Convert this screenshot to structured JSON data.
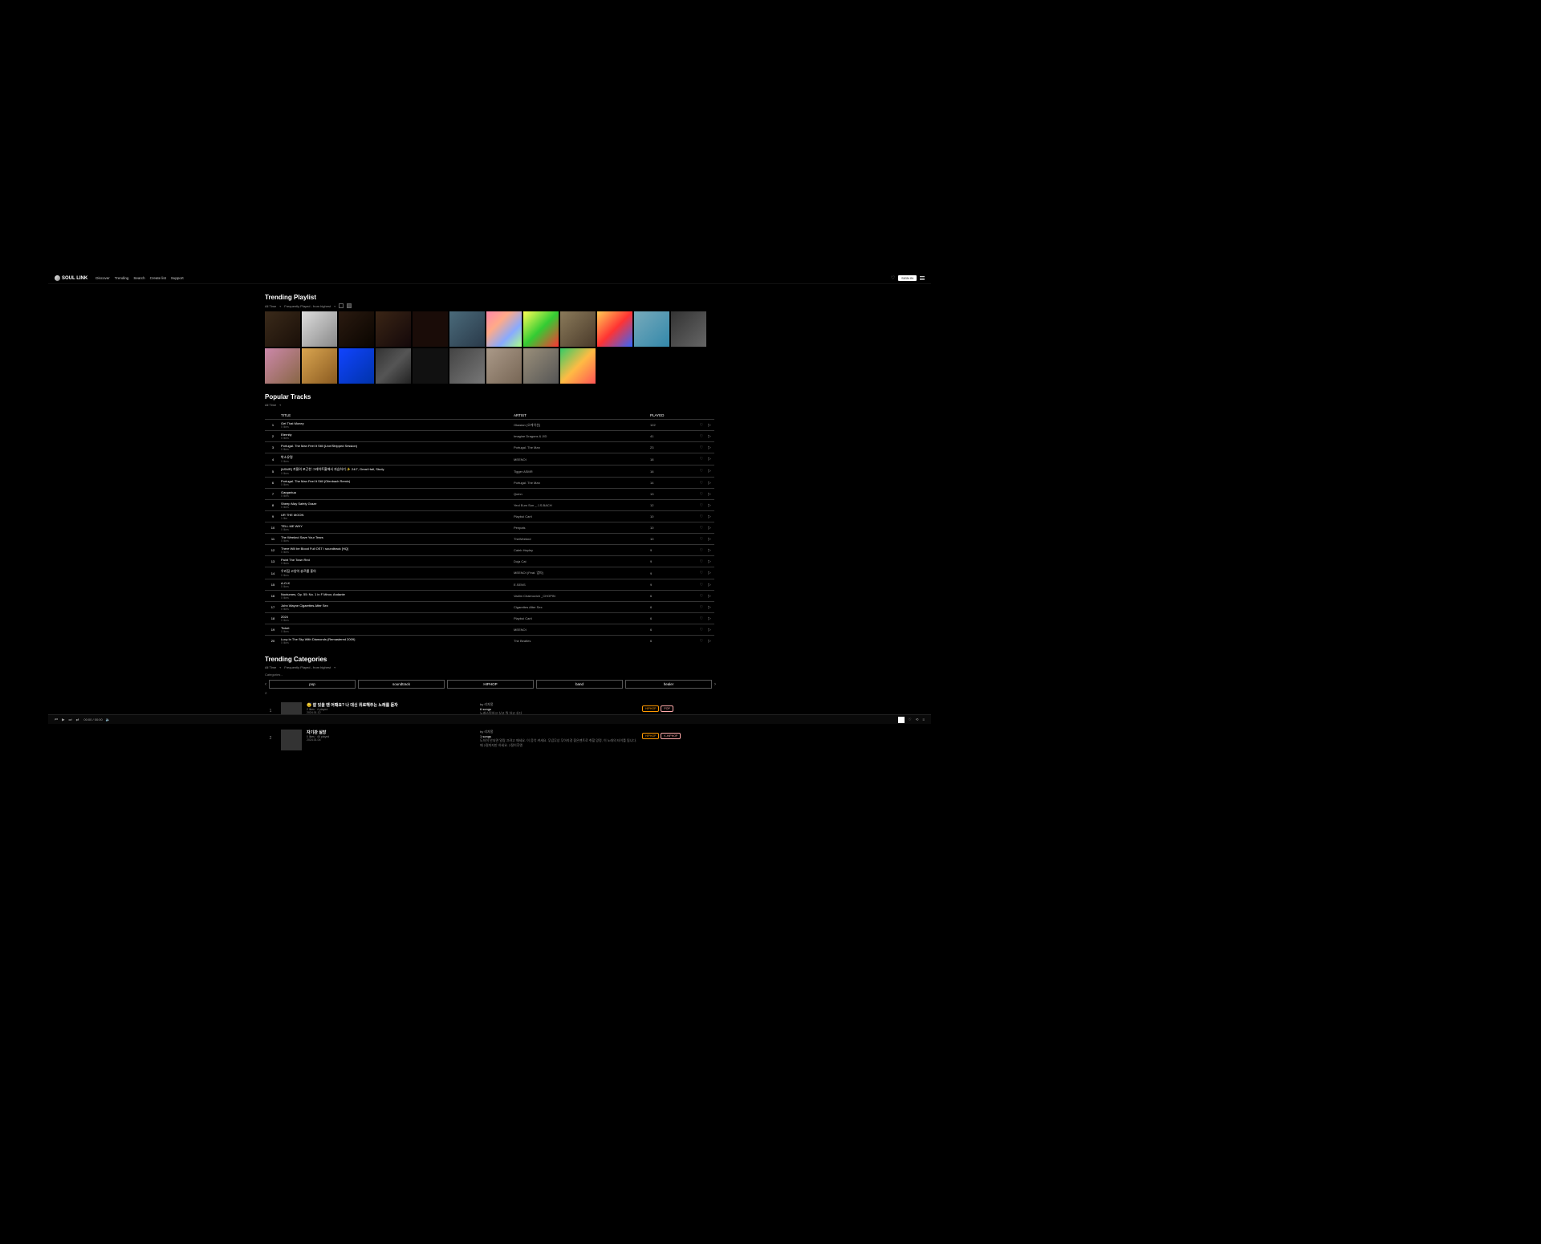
{
  "brand": "SOUL LINK",
  "nav": {
    "discover": "Discover",
    "trending": "Trending",
    "search": "Search",
    "create_list": "Create list",
    "support": "Support"
  },
  "signin": "SIGN IN",
  "sections": {
    "trending_playlist": "Trending Playlist",
    "popular_tracks": "Popular Tracks",
    "trending_categories": "Trending Categories"
  },
  "filters": {
    "all_time": "All Time",
    "freq": "Frequently Played - from highest"
  },
  "table": {
    "title": "TITLE",
    "artist": "ARTIST",
    "played": "PLAYED"
  },
  "category_label": "Categories -",
  "categories": [
    "pop",
    "soundtrack",
    "HIPHOP",
    "band",
    "healer"
  ],
  "tracks": [
    {
      "n": 1,
      "title": "Get That Money",
      "likes": "0 likes",
      "artist": "Okasian (오케이션)",
      "played": "122"
    },
    {
      "n": 2,
      "title": "Eternity",
      "likes": "0 likes",
      "artist": "Imagine Dragons & JID",
      "played": "41"
    },
    {
      "n": 3,
      "title": "Portugal. The Man Feel It Still (Live/Stripped Session)",
      "likes": "0 likes",
      "artist": "Portugal. The Man",
      "played": "23"
    },
    {
      "n": 4,
      "title": "박소유명",
      "likes": "0 likes",
      "artist": "MEENOI",
      "played": "18"
    },
    {
      "n": 5,
      "title": "[ASMR] 겨울의 포근한 그레이트홀에서 자습하기 ✨ 24/7, Great Hall, Study",
      "likes": "0 likes",
      "artist": "Tigger ASMR",
      "played": "16"
    },
    {
      "n": 6,
      "title": "Portugal. The Man Feel It Still (Ofenbach Remix)",
      "likes": "0 likes",
      "artist": "Portugal. The Man",
      "played": "14"
    },
    {
      "n": 7,
      "title": "Gargantua",
      "likes": "0 likes",
      "artist": "Quinn",
      "played": "13"
    },
    {
      "n": 8,
      "title": "Sheep May Safely Graze",
      "likes": "0 likes",
      "artist": "Yeol Eum Son _ J.S.BACH",
      "played": "12"
    },
    {
      "n": 9,
      "title": "UR THE MOON",
      "likes": "1 like",
      "artist": "Playboi Carti",
      "played": "10"
    },
    {
      "n": 10,
      "title": "TELL ME WHY",
      "likes": "0 likes",
      "artist": "Penpals",
      "played": "10"
    },
    {
      "n": 11,
      "title": "The Weeknd Save Your Tears",
      "likes": "0 likes",
      "artist": "TheWeeknd",
      "played": "10"
    },
    {
      "n": 12,
      "title": "There Will be Blood Full OST / soundtrack [HQ]",
      "likes": "0 likes",
      "artist": "Caleb Hepley",
      "played": "9"
    },
    {
      "n": 13,
      "title": "Paint The Town Red",
      "likes": "0 likes",
      "artist": "Doja Cat",
      "played": "9"
    },
    {
      "n": 14,
      "title": "우리집 고양이 츄르를 좋아",
      "likes": "0 likes",
      "artist": "MEENOI (Feat. 염따)",
      "played": "9"
    },
    {
      "n": 15,
      "title": "A-O-K",
      "likes": "0 likes",
      "artist": "E.SENS",
      "played": "9"
    },
    {
      "n": 16,
      "title": "Nocturnes, Op. 55: No. 1 in F Minor, Andante",
      "likes": "0 likes",
      "artist": "Vadim Chaimovich _CHOPIN",
      "played": "6"
    },
    {
      "n": 17,
      "title": "John Wayne Cigarettes After Sex",
      "likes": "0 likes",
      "artist": "Cigarettes After Sex",
      "played": "6"
    },
    {
      "n": 18,
      "title": "2024",
      "likes": "0 likes",
      "artist": "Playboi Carti",
      "played": "6"
    },
    {
      "n": 19,
      "title": "Ticket",
      "likes": "0 likes",
      "artist": "MEENOI",
      "played": "6"
    },
    {
      "n": 20,
      "title": "Lucy In The Sky With Diamonds (Remastered 2009)",
      "likes": "0 likes",
      "artist": "The Beatles",
      "played": "6"
    }
  ],
  "cat_items": [
    {
      "n": 1,
      "emoji": "😴",
      "title": "잘 있을 땐 어때요? 나 대신 위로해주는 노래를 듣자",
      "meta1": "2 likes · 4 played",
      "meta2": "2024.01.12",
      "by": "by 리자몽",
      "songs": "6 songs",
      "desc": "노래스킵하고 싶고 뭐 하고 싶다",
      "tags": [
        "HIPHOP",
        "POP"
      ]
    },
    {
      "n": 2,
      "emoji": "",
      "title": "자기관 실망",
      "meta1": "0 likes · 46 played",
      "meta2": "2024.01.04",
      "by": "by 리자몽",
      "songs": "1 songs",
      "desc": "도저히 안되면 알람 끄려고 깨세요. 이 음악 켜세요. 무념무상 무아지경 좋은맨트로 취할 망정, 이 노래의 타이틀 됩니다. 매 2절까지만 하세요. 2절이후엔",
      "tags": [
        "HIPHOP",
        "K-HIPHOP"
      ]
    }
  ],
  "player": {
    "time": "00:00 / 00:00"
  }
}
